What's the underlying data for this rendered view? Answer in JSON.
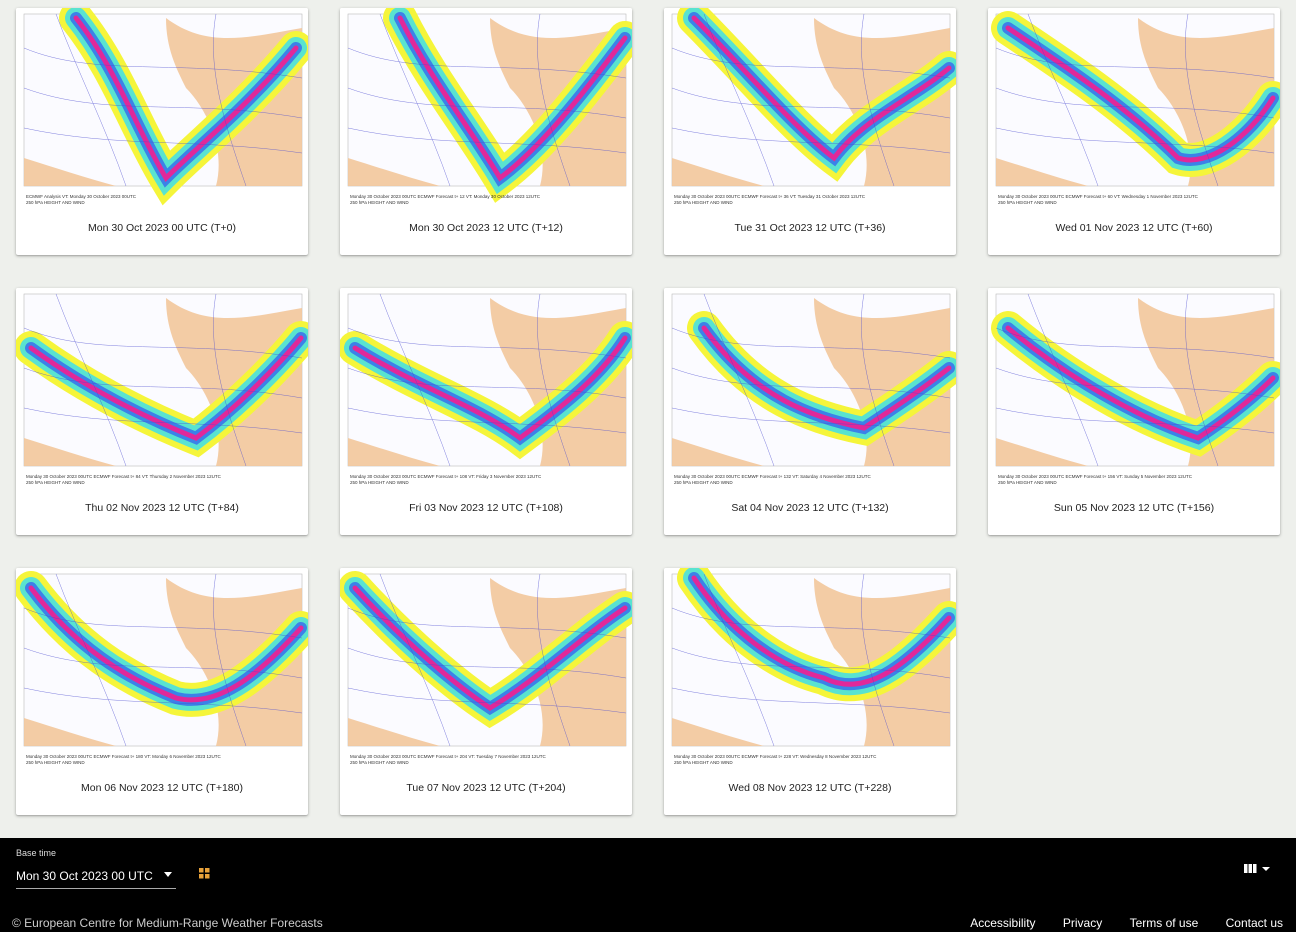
{
  "cards": [
    {
      "caption": "Mon 30 Oct 2023 00 UTC (T+0)",
      "map_title": "ECMWF Analysis VT: Monday 30 October 2023 00UTC",
      "map_subtitle": "250 hPa HEIGHT AND WIND"
    },
    {
      "caption": "Mon 30 Oct 2023 12 UTC (T+12)",
      "map_title": "Monday 30 October 2023 00UTC ECMWF Forecast t+ 12 VT: Monday 30 October 2023 12UTC",
      "map_subtitle": "250 hPa HEIGHT AND WIND"
    },
    {
      "caption": "Tue 31 Oct 2023 12 UTC (T+36)",
      "map_title": "Monday 30 October 2023 00UTC ECMWF Forecast t+ 36 VT: Tuesday 31 October 2023 12UTC",
      "map_subtitle": "250 hPa HEIGHT AND WIND"
    },
    {
      "caption": "Wed 01 Nov 2023 12 UTC (T+60)",
      "map_title": "Monday 30 October 2023 00UTC ECMWF Forecast t+ 60 VT: Wednesday 1 November 2023 12UTC",
      "map_subtitle": "250 hPa HEIGHT AND WIND"
    },
    {
      "caption": "Thu 02 Nov 2023 12 UTC (T+84)",
      "map_title": "Monday 30 October 2023 00UTC ECMWF Forecast t+ 84 VT: Thursday 2 November 2023 12UTC",
      "map_subtitle": "250 hPa HEIGHT AND WIND"
    },
    {
      "caption": "Fri 03 Nov 2023 12 UTC (T+108)",
      "map_title": "Monday 30 October 2023 00UTC ECMWF Forecast t+ 108 VT: Friday 3 November 2023 12UTC",
      "map_subtitle": "250 hPa HEIGHT AND WIND"
    },
    {
      "caption": "Sat 04 Nov 2023 12 UTC (T+132)",
      "map_title": "Monday 30 October 2023 00UTC ECMWF Forecast t+ 132 VT: Saturday 4 November 2023 12UTC",
      "map_subtitle": "250 hPa HEIGHT AND WIND"
    },
    {
      "caption": "Sun 05 Nov 2023 12 UTC (T+156)",
      "map_title": "Monday 30 October 2023 00UTC ECMWF Forecast t+ 156 VT: Sunday 5 November 2023 12UTC",
      "map_subtitle": "250 hPa HEIGHT AND WIND"
    },
    {
      "caption": "Mon 06 Nov 2023 12 UTC (T+180)",
      "map_title": "Monday 30 October 2023 00UTC ECMWF Forecast t+ 180 VT: Monday 6 November 2023 12UTC",
      "map_subtitle": "250 hPa HEIGHT AND WIND"
    },
    {
      "caption": "Tue 07 Nov 2023 12 UTC (T+204)",
      "map_title": "Monday 30 October 2023 00UTC ECMWF Forecast t+ 204 VT: Tuesday 7 November 2023 12UTC",
      "map_subtitle": "250 hPa HEIGHT AND WIND"
    },
    {
      "caption": "Wed 08 Nov 2023 12 UTC (T+228)",
      "map_title": "Monday 30 October 2023 00UTC ECMWF Forecast t+ 228 VT: Wednesday 8 November 2023 12UTC",
      "map_subtitle": "250 hPa HEIGHT AND WIND"
    }
  ],
  "controls": {
    "base_time_label": "Base time",
    "base_time_value": "Mon 30 Oct 2023 00 UTC",
    "grid_view_icon": "grid-icon",
    "layout_icon": "columns-icon"
  },
  "footer": {
    "copyright": "© European Centre for Medium-Range Weather Forecasts",
    "links": [
      "Accessibility",
      "Privacy",
      "Terms of use",
      "Contact us"
    ]
  },
  "colors": {
    "page_background": "#eef0ec",
    "footer_background": "#000000",
    "grid_icon": "#e8a23a",
    "land": "#f2c79b",
    "jet_weak": "#f5f53a",
    "jet_mid": "#59e3d0",
    "jet_strong": "#3b82e8",
    "jet_core": "#e0289a"
  }
}
